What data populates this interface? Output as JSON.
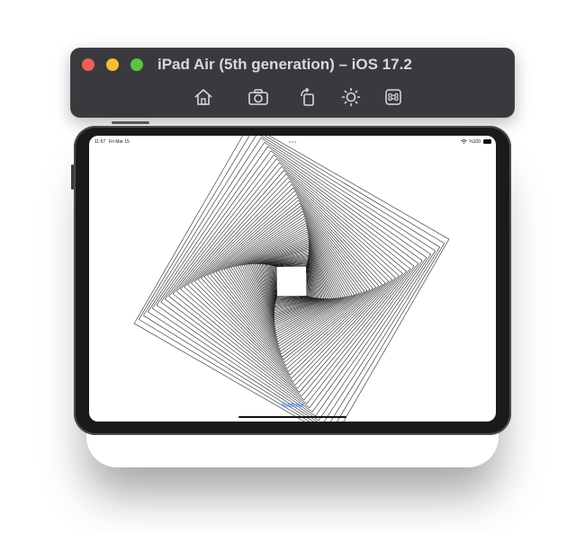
{
  "window": {
    "title": "iPad Air (5th generation) – iOS 17.2",
    "toolbar": [
      {
        "name": "home-button",
        "icon": "home-icon"
      },
      {
        "name": "screenshot-button",
        "icon": "camera-icon"
      },
      {
        "name": "rotate-button",
        "icon": "rotate-icon"
      },
      {
        "name": "appearance-button",
        "icon": "sun-icon"
      },
      {
        "name": "shortcut-button",
        "icon": "command-icon"
      }
    ],
    "colors": {
      "titlebar": "#3a393e",
      "close": "#ee5f57",
      "minimize": "#f4bd38",
      "zoom": "#5ec342"
    }
  },
  "status_bar": {
    "time": "11:57",
    "date": "Fri Mar 15",
    "battery": "%100"
  },
  "app": {
    "redraw_label": "Redraw",
    "link_color": "#2f7cf6",
    "pattern": {
      "shape": "nested-rotating-squares",
      "square_count": 60,
      "rotation_step_deg": 1,
      "shrink_factor": 0.966,
      "start_rotation_deg": 30,
      "stroke_color": "#111111"
    }
  }
}
